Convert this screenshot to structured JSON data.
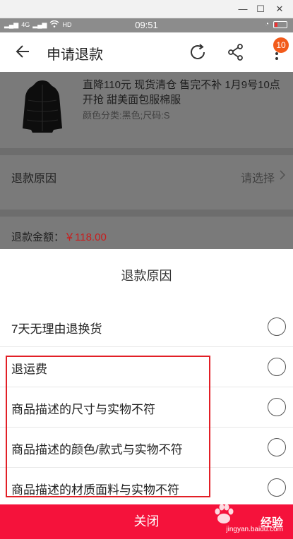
{
  "status_bar": {
    "network": "4G",
    "time": "09:51"
  },
  "header": {
    "title": "申请退款",
    "badge_count": "10"
  },
  "product": {
    "name": "直降110元 现货清仓 售完不补 1月9号10点开抢 甜美面包服棉服",
    "spec": "颜色分类:黑色;尺码:S"
  },
  "refund_reason_row": {
    "label": "退款原因",
    "placeholder": "请选择"
  },
  "refund_amount": {
    "label": "退款金额：",
    "value": "￥118.00"
  },
  "sheet": {
    "title": "退款原因",
    "options": [
      "7天无理由退换货",
      "退运费",
      "商品描述的尺寸与实物不符",
      "商品描述的颜色/款式与实物不符",
      "商品描述的材质面料与实物不符"
    ],
    "close_label": "关闭"
  },
  "watermark": {
    "text": "经验",
    "sub": "jingyan.baidu.com"
  },
  "colors": {
    "accent": "#f5123b",
    "price": "#c81d1d",
    "badge": "#f25b1b",
    "highlight": "#e21f26"
  }
}
